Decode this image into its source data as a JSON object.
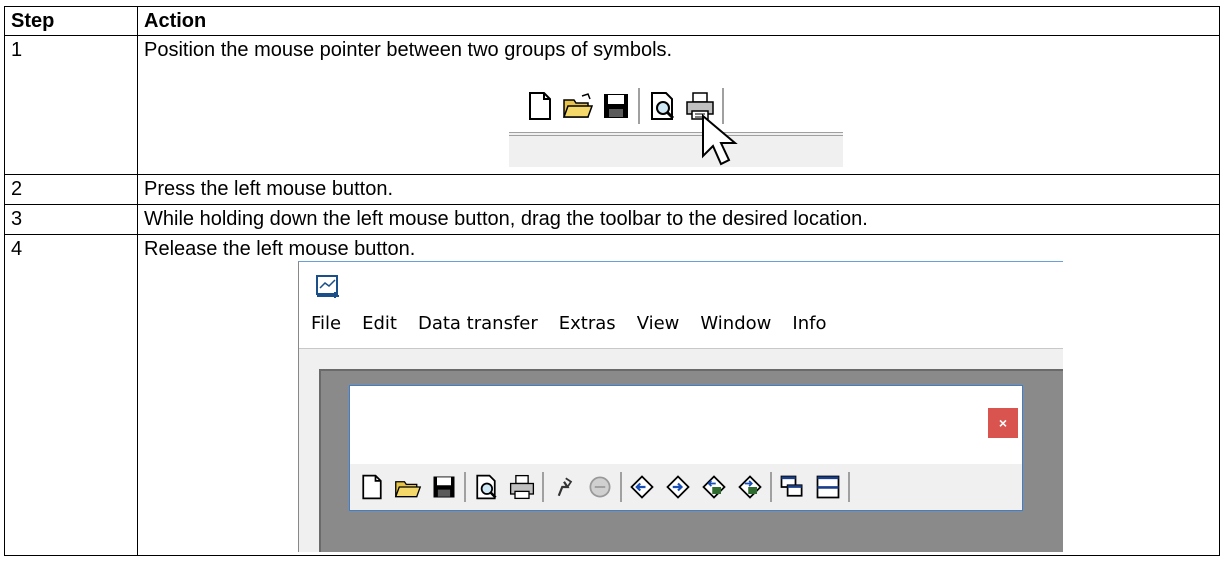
{
  "table": {
    "headers": [
      "Step",
      "Action"
    ],
    "rows": [
      {
        "step": "1",
        "action": "Position the mouse pointer between two groups of symbols."
      },
      {
        "step": "2",
        "action": "Press the left mouse button."
      },
      {
        "step": "3",
        "action": "While holding down the left mouse button, drag the toolbar to the desired location."
      },
      {
        "step": "4",
        "action": "Release the left mouse button."
      }
    ]
  },
  "figure1": {
    "icons": [
      "new-file-icon",
      "open-folder-icon",
      "save-icon",
      "print-preview-icon",
      "print-icon"
    ],
    "cursor": "mouse-pointer-icon"
  },
  "figure2": {
    "app_icon": "app-icon",
    "menu": [
      "File",
      "Edit",
      "Data transfer",
      "Extras",
      "View",
      "Window",
      "Info"
    ],
    "close_label": "×",
    "close_color": "#d9534f",
    "toolbar_icons": [
      "new-file-icon",
      "open-folder-icon",
      "save-icon",
      "print-preview-icon",
      "print-icon",
      "connect-icon",
      "disconnect-icon",
      "upload-icon",
      "download-icon",
      "upload-all-icon",
      "download-all-icon",
      "cascade-icon",
      "tile-icon"
    ]
  }
}
